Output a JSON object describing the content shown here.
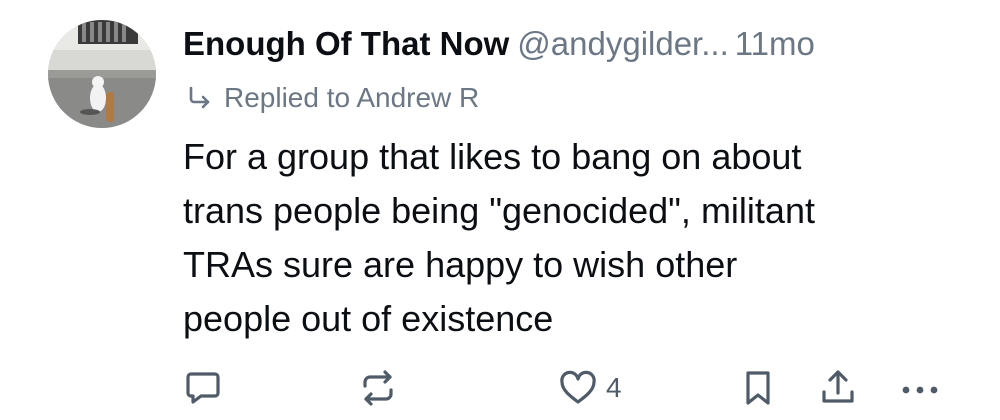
{
  "post": {
    "display_name": "Enough Of That Now",
    "handle": "@andygilder...",
    "time": "11mo",
    "reply_label": "Replied to Andrew R",
    "text": "For a group that likes to bang on about\ntrans people being \"genocided\", militant\nTRAs sure are happy to wish other\npeople out of existence"
  },
  "actions": {
    "reply_icon": "comment-icon",
    "repost_icon": "repost-icon",
    "like_icon": "heart-icon",
    "like_count": "4",
    "bookmark_icon": "bookmark-icon",
    "share_icon": "share-icon",
    "more_icon": "more-icon"
  },
  "colors": {
    "text": "#0b0f14",
    "muted": "#6b7785",
    "icon": "#4f5b68"
  }
}
